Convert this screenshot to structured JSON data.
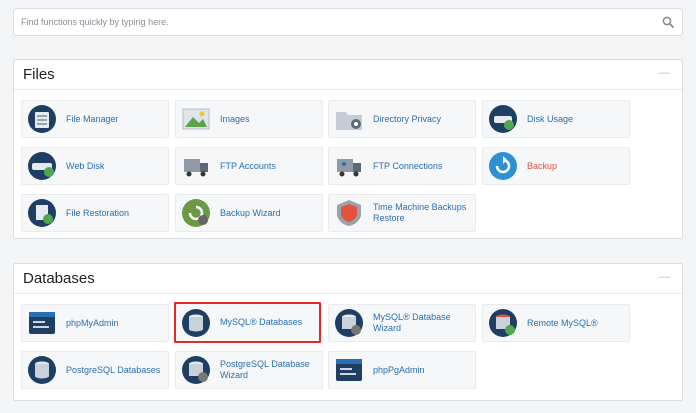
{
  "search": {
    "placeholder": "Find functions quickly by typing here."
  },
  "files": {
    "title": "Files",
    "collapse": "—",
    "items": [
      {
        "label": "File Manager",
        "icon": "file-manager-icon"
      },
      {
        "label": "Images",
        "icon": "images-icon"
      },
      {
        "label": "Directory Privacy",
        "icon": "directory-privacy-icon"
      },
      {
        "label": "Disk Usage",
        "icon": "disk-usage-icon"
      },
      {
        "label": "Web Disk",
        "icon": "web-disk-icon"
      },
      {
        "label": "FTP Accounts",
        "icon": "ftp-accounts-icon"
      },
      {
        "label": "FTP Connections",
        "icon": "ftp-connections-icon"
      },
      {
        "label": "Backup",
        "icon": "backup-icon"
      },
      {
        "label": "File Restoration",
        "icon": "file-restoration-icon"
      },
      {
        "label": "Backup Wizard",
        "icon": "backup-wizard-icon"
      },
      {
        "label": "Time Machine Backups Restore",
        "icon": "time-machine-icon"
      }
    ]
  },
  "databases": {
    "title": "Databases",
    "collapse": "—",
    "items": [
      {
        "label": "phpMyAdmin",
        "icon": "phpmyadmin-icon"
      },
      {
        "label": "MySQL® Databases",
        "icon": "mysql-databases-icon",
        "selected": true
      },
      {
        "label": "MySQL® Database Wizard",
        "icon": "mysql-wizard-icon"
      },
      {
        "label": "Remote MySQL®",
        "icon": "remote-mysql-icon"
      },
      {
        "label": "PostgreSQL Databases",
        "icon": "postgresql-databases-icon"
      },
      {
        "label": "PostgreSQL Database Wizard",
        "icon": "postgresql-wizard-icon"
      },
      {
        "label": "phpPgAdmin",
        "icon": "phppgadmin-icon"
      }
    ]
  },
  "colors": {
    "link": "#2a6fb0",
    "backup_label": "#e2533d",
    "selection_border": "#e02a2a"
  }
}
